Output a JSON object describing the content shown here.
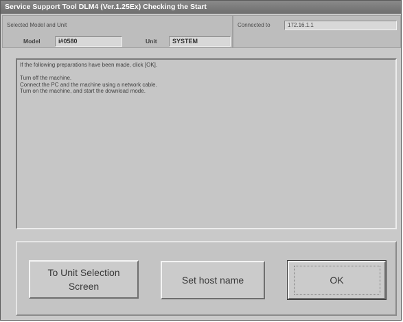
{
  "window": {
    "title": "Service Support Tool DLM4 (Ver.1.25Ex) Checking the Start"
  },
  "info": {
    "selected_label": "Selected Model and Unit",
    "model_label": "Model",
    "model_value": "i#0580",
    "unit_label": "Unit",
    "unit_value": "SYSTEM",
    "connected_label": "Connected to",
    "connected_value": "172.16.1.1"
  },
  "message": {
    "line1": "If the following preparations have been made, click [OK].",
    "line2": "Turn off the machine.",
    "line3": "Connect the PC and the machine using a network cable.",
    "line4": "Turn on the machine, and start the download mode."
  },
  "buttons": {
    "unit_selection": "To Unit Selection Screen",
    "set_host": "Set host name",
    "ok": "OK"
  }
}
